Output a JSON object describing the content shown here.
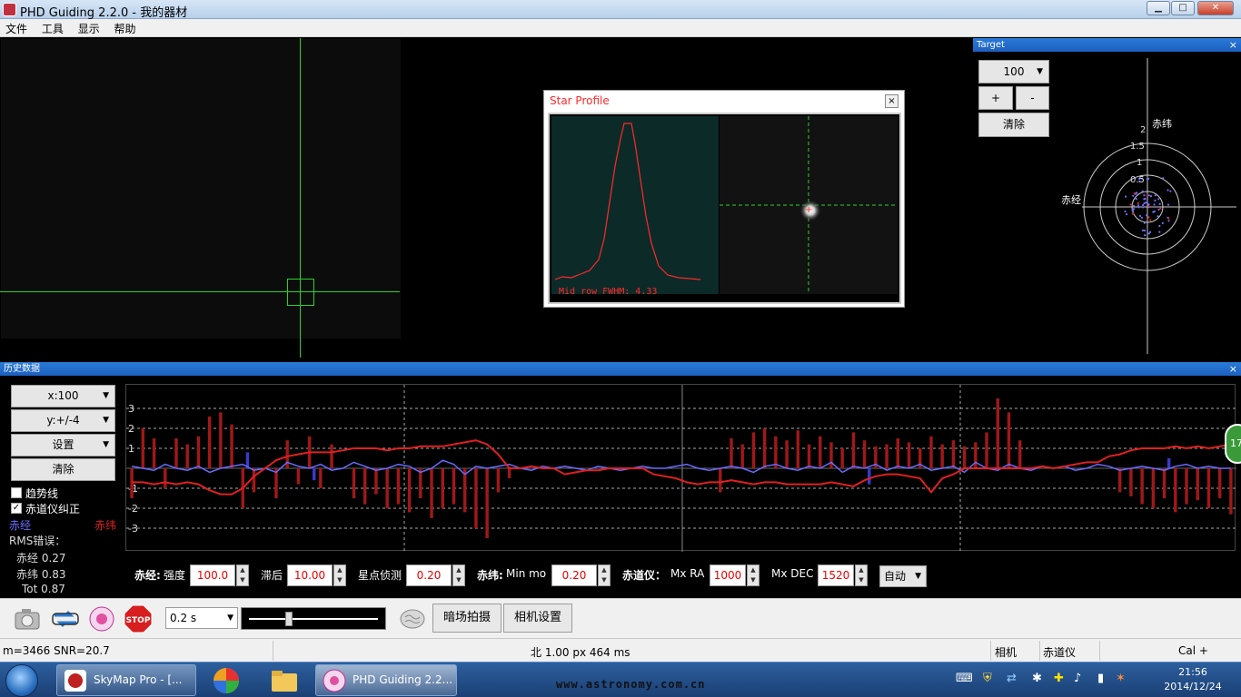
{
  "window": {
    "title": "PHD Guiding 2.2.0 - 我的器材",
    "min": "▁",
    "max": "□",
    "close": "✕"
  },
  "menu": [
    "文件",
    "工具",
    "显示",
    "帮助"
  ],
  "star_profile": {
    "title": "Star Profile",
    "close": "×",
    "fwhm_label": "Mid row FWHM: 4.33"
  },
  "target": {
    "header": "Target",
    "close": "×",
    "zoom_value": "100",
    "plus": "+",
    "minus": "-",
    "clear": "清除",
    "dec_label": "赤纬",
    "ra_label": "赤经",
    "ring_labels": [
      "2",
      "1.5",
      "1",
      "0.5"
    ]
  },
  "history": {
    "header": "历史数据",
    "close": "×",
    "x_btn": "x:100",
    "y_btn": "y:+/-4",
    "settings_btn": "设置",
    "clear_btn": "清除",
    "trend_label": "趋势线",
    "ra_correct_label": "赤道仪纠正",
    "ra_legend": "赤经",
    "dec_legend": "赤纬",
    "rms_title": "RMS错误：",
    "rms_ra": "赤经 0.27",
    "rms_dec": "赤纬 0.83",
    "rms_tot": "Tot 0.87",
    "y_ticks": [
      "3",
      "2",
      "1",
      "-1",
      "-2",
      "-3"
    ],
    "badge": "17",
    "colors": {
      "ra": "#6a6aff",
      "dec": "#e02020",
      "ra_bar": "#3a3acc",
      "dec_bar": "#a01818"
    }
  },
  "controls": {
    "ra_title": "赤经:",
    "aggr_label": "强度",
    "aggr_value": "100.0",
    "hyst_label": "滞后",
    "hyst_value": "10.00",
    "minmo_label": "星点侦测",
    "minmo_value": "0.20",
    "dec_title": "赤纬:",
    "dec_minmo_label": "Min mo",
    "dec_minmo_value": "0.20",
    "mount_title": "赤道仪：",
    "mxra_label": "Mx RA",
    "mxra_value": "1000",
    "mxdec_label": "Mx DEC",
    "mxdec_value": "1520",
    "mode_value": "自动"
  },
  "toolbar": {
    "exposure": "0.2 s",
    "dark_btn": "暗场拍摄",
    "camera_settings_btn": "相机设置",
    "stop_label": "STOP"
  },
  "status": {
    "star_info": "m=3466 SNR=20.7",
    "guide_info": "北 1.00 px 464 ms",
    "camera": "相机",
    "mount": "赤道仪",
    "cal": "Cal +"
  },
  "taskbar": {
    "skymap": "SkyMap Pro - [...",
    "phd": "PHD Guiding 2.2...",
    "url": "www.astronomy.com.cn",
    "time": "21:56",
    "date": "2014/12/24"
  },
  "chart_data": {
    "type": "line",
    "x_window": 100,
    "ylim": [
      -4,
      4
    ],
    "y_ticks": [
      3,
      2,
      1,
      -1,
      -2,
      -3
    ],
    "series": [
      {
        "name": "赤经",
        "values": [
          0.1,
          0.0,
          -0.1,
          0.2,
          0.0,
          -0.1,
          0.1,
          -0.2,
          0.0,
          0.1,
          0.2,
          -0.1,
          0.0,
          -0.2,
          0.3,
          0.1,
          0.0,
          0.2,
          -0.1,
          0.0,
          0.3,
          0.1,
          -0.1,
          0.0,
          0.2,
          0.1,
          -0.2,
          0.0,
          0.4,
          0.2,
          -0.3,
          0.1,
          0.0,
          0.1,
          0.2,
          0.0,
          -0.1,
          0.1,
          0.0,
          0.1,
          0.0,
          -0.1,
          0.1,
          0.0,
          -0.1,
          0.0,
          0.1,
          0.0,
          0.0,
          0.1,
          0.2,
          0.0,
          -0.1,
          0.0,
          0.1,
          0.0,
          -0.2,
          0.1,
          0.2,
          0.0,
          -0.1,
          0.1,
          0.0,
          0.3,
          -0.2,
          0.1,
          0.0,
          0.2,
          -0.1,
          0.1,
          0.0,
          0.2,
          -0.1,
          0.0,
          0.1,
          -0.2,
          0.3,
          0.0,
          -0.1,
          0.2,
          0.0,
          -0.1,
          0.1,
          0.0,
          0.1,
          -0.1,
          0.0,
          0.2,
          0.1,
          -0.1,
          0.0,
          0.1,
          0.0,
          -0.1,
          0.1,
          0.2,
          0.0,
          0.1,
          0.0,
          0.0
        ]
      },
      {
        "name": "赤纬",
        "values": [
          -0.7,
          -0.7,
          -0.8,
          -0.7,
          -0.8,
          -0.7,
          -0.8,
          -1.1,
          -1.3,
          -1.3,
          -1.0,
          -0.4,
          0.0,
          0.4,
          0.6,
          0.7,
          0.8,
          0.8,
          0.8,
          0.9,
          1.0,
          1.0,
          1.0,
          0.9,
          1.0,
          1.0,
          1.1,
          1.1,
          1.1,
          1.2,
          1.3,
          1.4,
          1.2,
          0.7,
          0.0,
          0.0,
          0.1,
          0.0,
          0.0,
          -0.3,
          -0.2,
          -0.1,
          -0.1,
          0.0,
          0.0,
          0.0,
          0.0,
          -0.3,
          -0.4,
          -0.5,
          -0.7,
          -0.8,
          -0.7,
          -0.7,
          -0.6,
          -0.7,
          -0.8,
          -0.7,
          -0.7,
          -0.8,
          -0.8,
          -0.8,
          -0.8,
          -0.7,
          -0.8,
          -0.9,
          -0.6,
          -0.4,
          -0.3,
          -0.3,
          -0.4,
          -0.5,
          -1.2,
          -0.5,
          -0.3,
          0.0,
          0.0,
          0.0,
          0.0,
          0.0,
          0.0,
          0.0,
          0.1,
          0.0,
          0.1,
          0.2,
          0.3,
          0.3,
          0.6,
          0.7,
          0.9,
          1.0,
          1.0,
          1.0,
          1.1,
          1.0,
          1.1,
          1.0,
          1.1,
          1.2
        ]
      }
    ],
    "dec_corrections": [
      -1.5,
      2.0,
      1.5,
      -1.0,
      1.5,
      1.2,
      1.6,
      2.6,
      2.8,
      2.2,
      -2.0,
      -1.2,
      0.0,
      -1.5,
      1.4,
      -0.8,
      1.6,
      -1.0,
      1.2,
      0.0,
      -1.5,
      -1.8,
      -1.3,
      -2.0,
      -1.8,
      -2.2,
      -1.5,
      -2.5,
      -2.0,
      -1.8,
      -2.2,
      -3.0,
      -3.5,
      -1.2,
      -0.5,
      0.0,
      0.0,
      0.0,
      0.0,
      0.0,
      0.0,
      0.0,
      0.0,
      0.0,
      0.0,
      0.0,
      0.0,
      0.0,
      0.0,
      0.0,
      0.0,
      0.0,
      0.0,
      -1.2,
      1.5,
      1.2,
      1.8,
      2.0,
      1.6,
      1.4,
      1.9,
      1.2,
      1.6,
      1.3,
      1.0,
      1.8,
      1.4,
      1.1,
      1.2,
      1.5,
      1.3,
      1.0,
      1.6,
      1.2,
      1.4,
      1.1,
      1.3,
      1.8,
      3.5,
      2.8,
      1.4,
      0.0,
      0.0,
      0.0,
      0.0,
      0.0,
      0.0,
      0.0,
      0.0,
      -1.2,
      -1.4,
      -1.8,
      -2.0,
      -1.5,
      -2.2,
      -1.8,
      -1.6,
      -2.0,
      -1.5,
      -2.3
    ],
    "ra_corrections": [
      0.0,
      0.0,
      0.0,
      0.0,
      0.0,
      0.0,
      0.0,
      0.0,
      0.0,
      0.0,
      0.8,
      0.0,
      0.0,
      0.0,
      0.0,
      0.0,
      -0.6,
      0.0,
      0.0,
      0.0,
      0.0,
      0.0,
      0.0,
      0.0,
      0.0,
      0.0,
      0.0,
      0.0,
      0.0,
      0.0,
      0.0,
      0.0,
      0.0,
      0.0,
      0.0,
      0.0,
      0.0,
      0.0,
      0.0,
      0.0,
      0.0,
      0.0,
      0.0,
      0.0,
      0.0,
      0.0,
      0.0,
      0.0,
      0.0,
      0.0,
      0.0,
      0.0,
      0.0,
      0.0,
      0.0,
      0.0,
      0.0,
      0.0,
      0.0,
      0.0,
      0.0,
      0.0,
      0.0,
      0.0,
      0.0,
      0.0,
      -0.8,
      0.0,
      0.0,
      0.0,
      0.0,
      0.0,
      0.0,
      0.0,
      0.0,
      0.0,
      0.0,
      0.0,
      0.0,
      0.0,
      0.0,
      0.0,
      0.0,
      0.0,
      0.0,
      0.0,
      0.0,
      0.0,
      0.0,
      0.0,
      0.0,
      0.0,
      0.0,
      0.5,
      0.0,
      0.0,
      0.0,
      0.0,
      0.0,
      0.0
    ]
  }
}
